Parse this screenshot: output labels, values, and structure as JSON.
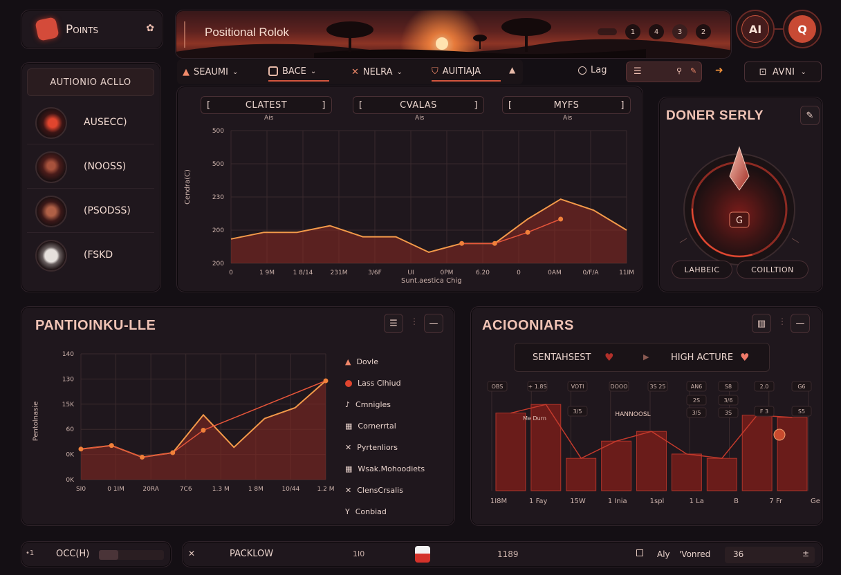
{
  "brand": {
    "label": "Points"
  },
  "banner": {
    "title": "Positional Rolok",
    "pages": [
      "1",
      "4",
      "3",
      "2"
    ]
  },
  "top_buttons": {
    "ai": "AI",
    "search": "Q"
  },
  "tabs": [
    {
      "label": "SEAUMI"
    },
    {
      "label": "BACE"
    },
    {
      "label": "NELRA"
    },
    {
      "label": "AUITIAJA"
    }
  ],
  "toolbar": {
    "log_label": "Lag",
    "avni_label": "AVNI"
  },
  "sidebar": {
    "title": "AUTIONIO ACLLO",
    "items": [
      {
        "label": "AUSECC)"
      },
      {
        "label": "(NOOSS)"
      },
      {
        "label": "(PSODSS)"
      },
      {
        "label": "(FSKD"
      }
    ]
  },
  "main_chart": {
    "filters": [
      {
        "label": "CLATEST",
        "sub": "Ais"
      },
      {
        "label": "CVALAS",
        "sub": "Ais"
      },
      {
        "label": "MYFS",
        "sub": "Ais"
      }
    ],
    "xlabel": "Sunt.aestica Chig",
    "ylabel": "Cendra(C)"
  },
  "gauge_panel": {
    "title": "DONER SERLY",
    "center_glyph": "G",
    "buttons": [
      "LAHBEIC",
      "COILLTION"
    ]
  },
  "left_bottom": {
    "title": "PANTIOINKU-LLE",
    "ylabel": "Pentolnasie",
    "legend": [
      {
        "icon": "triangle",
        "label": "Dovle"
      },
      {
        "icon": "dot",
        "label": "Lass Clhiud"
      },
      {
        "icon": "note",
        "label": "Cmnigles"
      },
      {
        "icon": "grid",
        "label": "Cornerrtal"
      },
      {
        "icon": "x",
        "label": "Pyrtenliors"
      },
      {
        "icon": "grid",
        "label": "Wsak.Mohoodiets"
      },
      {
        "icon": "x",
        "label": "ClensCrsalis"
      },
      {
        "icon": "y",
        "label": "Conbiad"
      }
    ]
  },
  "right_bottom": {
    "title": "ACIOONIARS",
    "toggle_left": "SENTAHSEST",
    "toggle_right": "HIGH ACTURE",
    "labels": [
      "Me Durn",
      "HANNOOSL"
    ],
    "badges": [
      "OBS",
      "+ 1.8S",
      "VOTI",
      "DOOO",
      "3S 25",
      "AN6",
      "S8",
      "2.0",
      "G6",
      "2S",
      "3/6",
      "3/5",
      "3S",
      "3/5",
      "F 3",
      "S5"
    ]
  },
  "status_bar": {
    "left_value": "OCC(H)",
    "left_prefix": "•1",
    "track_label": "PACKLOW",
    "track_num": "1I0",
    "count": "1189",
    "ahy_label": "Aly",
    "monitor_label": "'Vonred",
    "value": "36"
  },
  "chart_data": [
    {
      "type": "area",
      "title": "",
      "x": [
        "0",
        "1 9M",
        "1 8/14",
        "231M",
        "3/6F",
        "UI",
        "0PM",
        "6.20",
        "0",
        "0AM",
        "0/F/A",
        "11IM"
      ],
      "ylim": [
        200,
        500
      ],
      "yticks": [
        "500",
        "500",
        "230",
        "200",
        "200"
      ],
      "series": [
        {
          "values": [
            255,
            270,
            270,
            285,
            260,
            260,
            225,
            245,
            245,
            300,
            345,
            320,
            275
          ]
        },
        {
          "values": [
            null,
            null,
            null,
            null,
            null,
            null,
            null,
            245,
            245,
            270,
            300,
            null,
            null
          ]
        }
      ]
    },
    {
      "type": "area",
      "title": "",
      "x": [
        "SI0",
        "0 1IM",
        "20RA",
        "7C6",
        "1.3 M",
        "1 8M",
        "10/44",
        "1.2 M"
      ],
      "ylim": [
        0,
        140
      ],
      "yticks": [
        "140",
        "130",
        "15K",
        "60",
        "0K",
        "0K"
      ],
      "series": [
        {
          "values": [
            34,
            38,
            25,
            30,
            72,
            36,
            68,
            80,
            110
          ]
        },
        {
          "values": [
            34,
            38,
            25,
            30,
            55,
            null,
            null,
            null,
            110
          ]
        }
      ]
    },
    {
      "type": "bar",
      "title": "",
      "x": [
        "1I8M",
        "1 Fay",
        "15W",
        "1 Inia",
        "1spl",
        "1 La",
        "B",
        "7 Fr",
        "Ge"
      ],
      "ylim": [
        0,
        100
      ],
      "values": [
        72,
        80,
        30,
        46,
        55,
        34,
        30,
        70,
        68
      ]
    }
  ]
}
